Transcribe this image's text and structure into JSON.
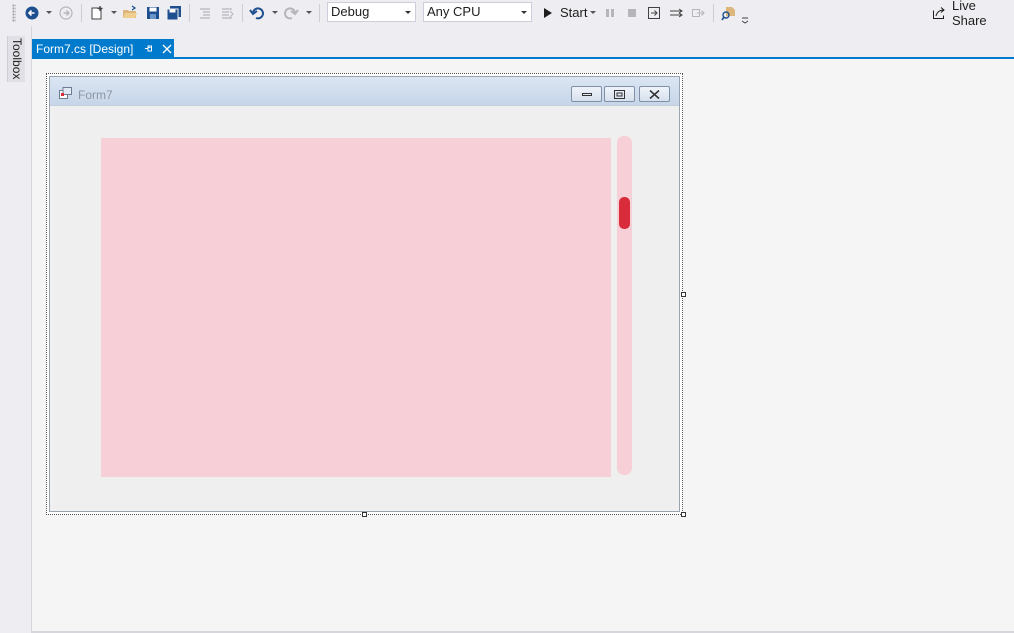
{
  "toolbar": {
    "configuration": "Debug",
    "platform": "Any CPU",
    "start_label": "Start",
    "live_share_label": "Live Share"
  },
  "toolbox": {
    "label": "Toolbox"
  },
  "document_tab": {
    "label": "Form7.cs [Design]"
  },
  "form": {
    "title": "Form7",
    "scrollbar": {
      "thumb_position_percent": 20
    }
  },
  "colors": {
    "accent": "#007acc",
    "panel_pink": "#f7cfd6",
    "scroll_thumb": "#d92c3b"
  }
}
